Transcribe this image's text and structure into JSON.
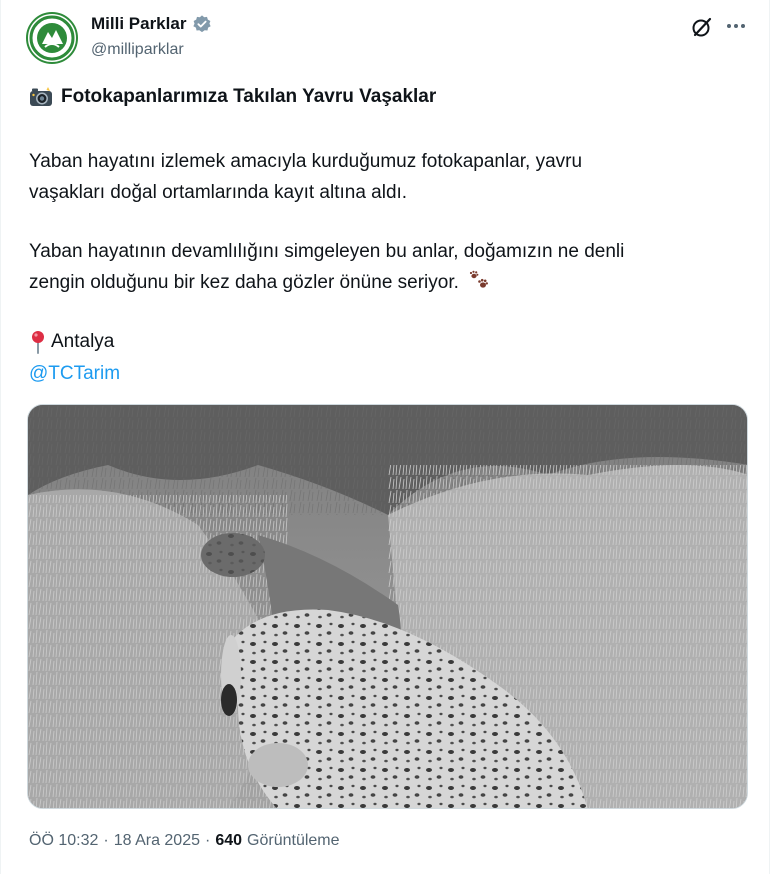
{
  "author": {
    "display_name": "Milli Parklar",
    "handle": "@milliparklar",
    "verified": true,
    "accent_color": "#2e8b3a"
  },
  "icons": {
    "verified": "verified-badge-icon",
    "grok": "grok-icon",
    "more": "more-icon",
    "camera": "camera-flash-icon",
    "paw": "paw-prints-icon",
    "pin": "round-pushpin-icon"
  },
  "tweet": {
    "title": "Fotokapanlarımıza Takılan Yavru Vaşaklar",
    "paragraph1_line1": "Yaban hayatını izlemek amacıyla kurduğumuz fotokapanlar, yavru",
    "paragraph1_line2": "vaşakları doğal ortamlarında kayıt altına aldı.",
    "paragraph2_line1": "Yaban hayatının devamlılığını simgeleyen bu anlar, doğamızın ne denli",
    "paragraph2_line2": "zengin olduğunu bir kez daha gözler önüne seriyor.",
    "location": "Antalya",
    "mention": "@TCTarim",
    "link_color": "#1d9bf0"
  },
  "meta": {
    "time": "ÖÖ 10:32",
    "separator": "·",
    "date": "18 Ara 2025",
    "views_count": "640",
    "views_label": "Görüntüleme"
  }
}
